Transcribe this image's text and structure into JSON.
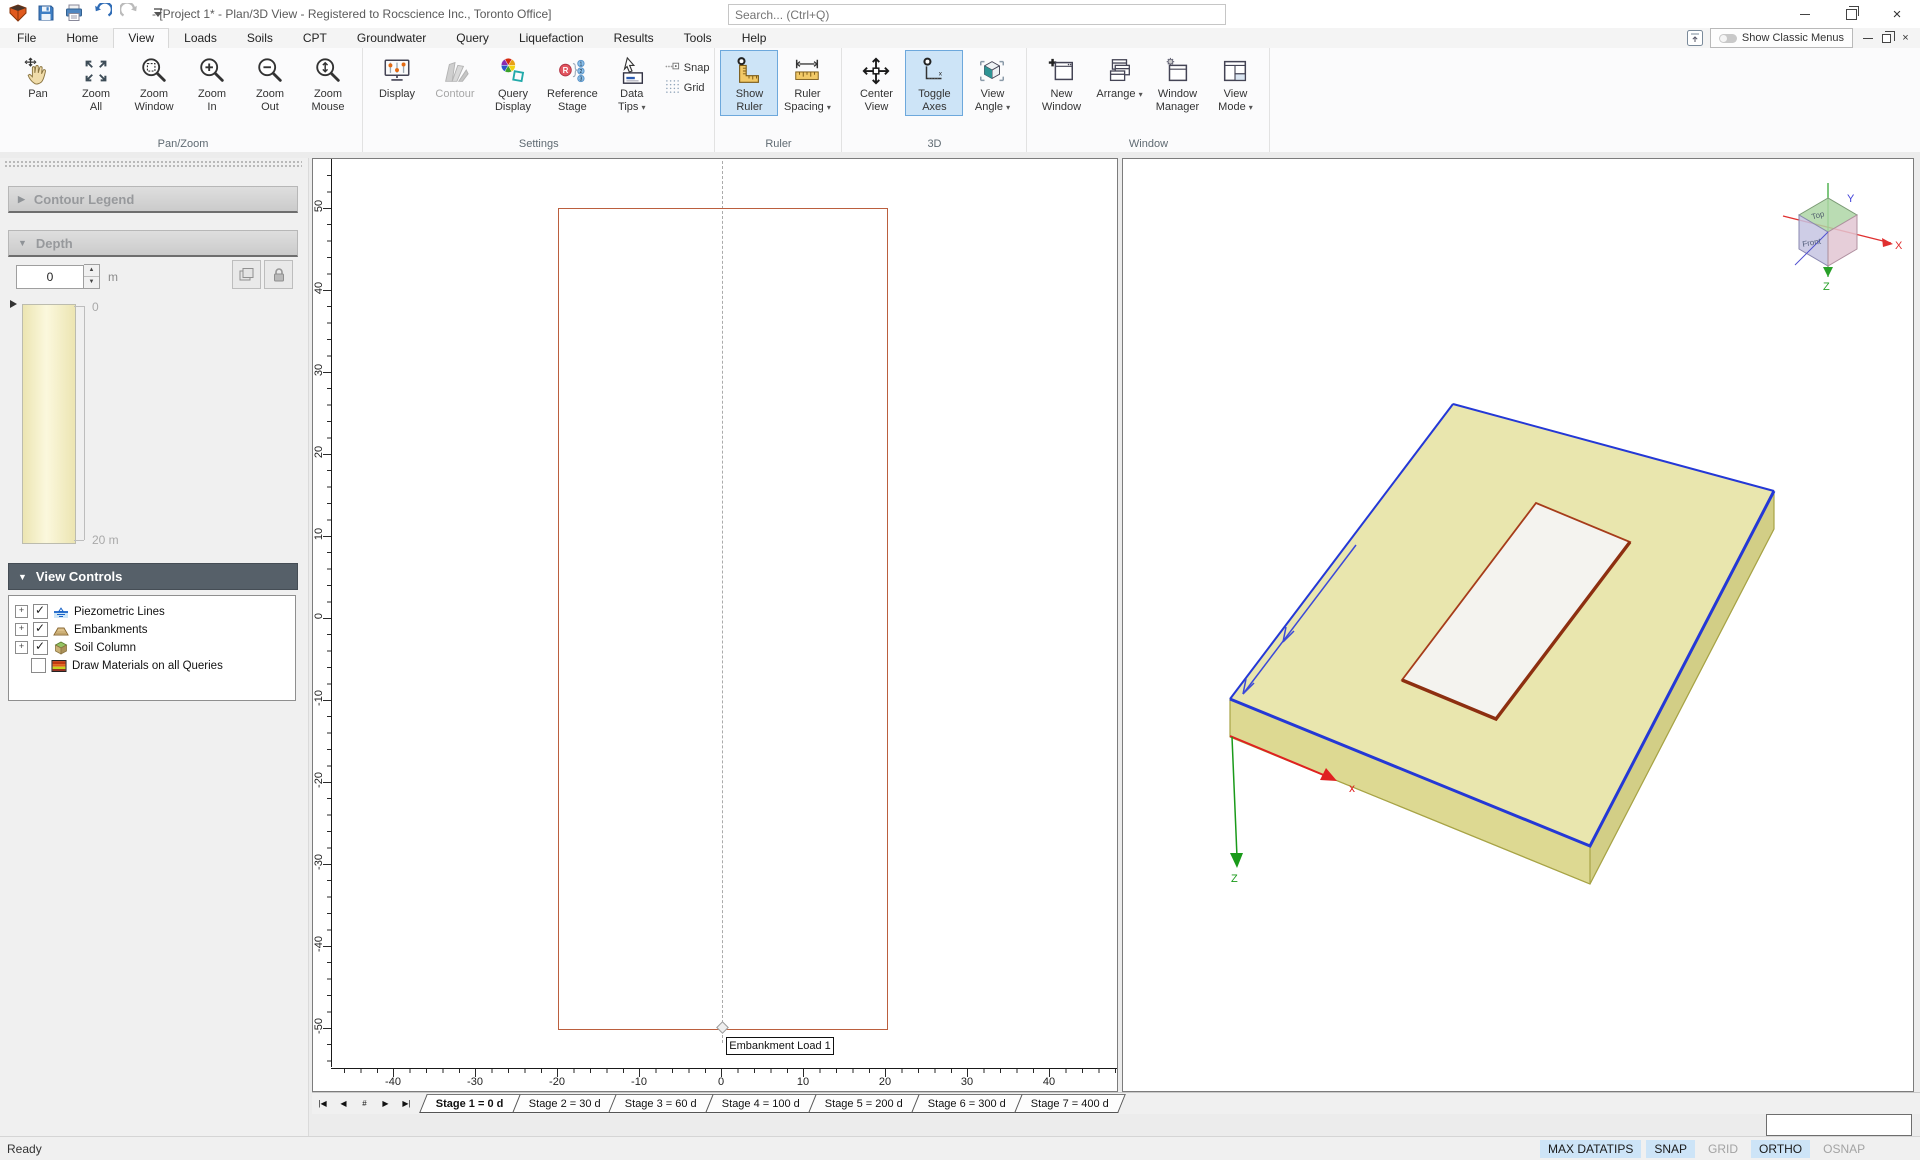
{
  "window": {
    "title": "- [Project 1* - Plan/3D View - Registered to Rocscience Inc., Toronto Office]",
    "search_placeholder": "Search... (Ctrl+Q)",
    "show_classic_menus": "Show Classic Menus",
    "qat_icons": [
      "app-logo-icon",
      "save-icon",
      "print-icon",
      "undo-icon",
      "redo-icon",
      "qat-caret-icon"
    ]
  },
  "menu": {
    "active": "View",
    "tabs": [
      "File",
      "Home",
      "View",
      "Loads",
      "Soils",
      "CPT",
      "Groundwater",
      "Query",
      "Liquefaction",
      "Results",
      "Tools",
      "Help"
    ]
  },
  "ribbon": {
    "groups": [
      {
        "label": "Pan/Zoom",
        "items": [
          {
            "name": "pan",
            "icon": "pan-icon",
            "lines": [
              "Pan"
            ]
          },
          {
            "name": "zoom-all",
            "icon": "zoom-all-icon",
            "lines": [
              "Zoom",
              "All"
            ]
          },
          {
            "name": "zoom-window",
            "icon": "zoom-window-icon",
            "lines": [
              "Zoom",
              "Window"
            ]
          },
          {
            "name": "zoom-in",
            "icon": "zoom-in-icon",
            "lines": [
              "Zoom",
              "In"
            ]
          },
          {
            "name": "zoom-out",
            "icon": "zoom-out-icon",
            "lines": [
              "Zoom",
              "Out"
            ]
          },
          {
            "name": "zoom-mouse",
            "icon": "zoom-mouse-icon",
            "lines": [
              "Zoom",
              "Mouse"
            ]
          }
        ]
      },
      {
        "label": "Settings",
        "items": [
          {
            "name": "display",
            "icon": "display-icon",
            "lines": [
              "Display"
            ]
          },
          {
            "name": "contour",
            "icon": "contour-icon",
            "lines": [
              "Contour"
            ],
            "disabled": true
          },
          {
            "name": "query-display",
            "icon": "query-display-icon",
            "lines": [
              "Query",
              "Display"
            ]
          },
          {
            "name": "reference-stage",
            "icon": "reference-stage-icon",
            "lines": [
              "Reference",
              "Stage"
            ]
          },
          {
            "name": "data-tips",
            "icon": "data-tips-icon",
            "lines": [
              "Data",
              "Tips"
            ],
            "dropdown": true
          },
          {
            "name": "snap-grid",
            "stack": [
              {
                "name": "snap",
                "icon": "snap-icon",
                "label": "Snap"
              },
              {
                "name": "grid",
                "icon": "grid-icon",
                "label": "Grid"
              }
            ]
          }
        ]
      },
      {
        "label": "Ruler",
        "items": [
          {
            "name": "show-ruler",
            "icon": "show-ruler-icon",
            "lines": [
              "Show",
              "Ruler"
            ],
            "active": true
          },
          {
            "name": "ruler-spacing",
            "icon": "ruler-spacing-icon",
            "lines": [
              "Ruler",
              "Spacing"
            ],
            "dropdown": true
          }
        ]
      },
      {
        "label": "3D",
        "items": [
          {
            "name": "center-view",
            "icon": "center-view-icon",
            "lines": [
              "Center",
              "View"
            ]
          },
          {
            "name": "toggle-axes",
            "icon": "toggle-axes-icon",
            "lines": [
              "Toggle",
              "Axes"
            ],
            "active": true
          },
          {
            "name": "view-angle",
            "icon": "view-angle-icon",
            "lines": [
              "View",
              "Angle"
            ],
            "dropdown": true
          }
        ]
      },
      {
        "label": "Window",
        "items": [
          {
            "name": "new-window",
            "icon": "new-window-icon",
            "lines": [
              "New",
              "Window"
            ]
          },
          {
            "name": "arrange",
            "icon": "arrange-icon",
            "lines": [
              "Arrange"
            ],
            "dropdown": true
          },
          {
            "name": "window-manager",
            "icon": "window-manager-icon",
            "lines": [
              "Window",
              "Manager"
            ]
          },
          {
            "name": "view-mode",
            "icon": "view-mode-icon",
            "lines": [
              "View",
              "Mode"
            ],
            "dropdown": true
          }
        ]
      }
    ]
  },
  "left_panel": {
    "contour_legend_title": "Contour Legend",
    "depth": {
      "title": "Depth",
      "value": "0",
      "unit": "m",
      "scale_top": "0",
      "scale_bottom": "20 m"
    },
    "view_controls": {
      "title": "View Controls",
      "items": [
        {
          "label": "Piezometric Lines",
          "icon": "piezometric-icon",
          "checked": true,
          "expandable": true
        },
        {
          "label": "Embankments",
          "icon": "embankment-icon",
          "checked": true,
          "expandable": true
        },
        {
          "label": "Soil Column",
          "icon": "soil-column-icon",
          "checked": true,
          "expandable": true
        },
        {
          "label": "Draw Materials on all Queries",
          "icon": "materials-icon",
          "checked": false,
          "expandable": false
        }
      ]
    }
  },
  "plan_view": {
    "x_ticks": [
      -40,
      -30,
      -20,
      -10,
      0,
      10,
      20,
      30,
      40
    ],
    "y_ticks": [
      50,
      40,
      30,
      20,
      10,
      0,
      -10,
      -20,
      -30,
      -40,
      -50
    ],
    "load_label": "Embankment Load 1"
  },
  "view_3d": {
    "cube_top": "Top",
    "cube_front": "Front",
    "axis_x": "X",
    "axis_y": "Y",
    "axis_z": "Z",
    "model_axis_x": "x",
    "model_axis_z": "Z"
  },
  "stage_bar": {
    "nav": [
      "|◀",
      "◀",
      "#",
      "▶",
      "▶|"
    ],
    "active": "Stage 1 = 0 d",
    "stages": [
      "Stage 1 = 0 d",
      "Stage 2 = 30 d",
      "Stage 3 = 60 d",
      "Stage 4 = 100 d",
      "Stage 5 = 200 d",
      "Stage 6 = 300 d",
      "Stage 7 = 400 d"
    ]
  },
  "status": {
    "ready": "Ready",
    "toggles": [
      {
        "label": "MAX DATATIPS",
        "on": true
      },
      {
        "label": "SNAP",
        "on": true
      },
      {
        "label": "GRID",
        "on": false
      },
      {
        "label": "ORTHO",
        "on": true
      },
      {
        "label": "OSNAP",
        "on": false
      }
    ]
  },
  "colors": {
    "ribbon_active_bg": "#cde4f7",
    "slab_fill": "#e9e6ae",
    "edge_blue": "#2438d6",
    "load_outline": "#a63c1a",
    "plan_outline": "#bb5f3e",
    "status_on_bg": "#cde4f7"
  }
}
